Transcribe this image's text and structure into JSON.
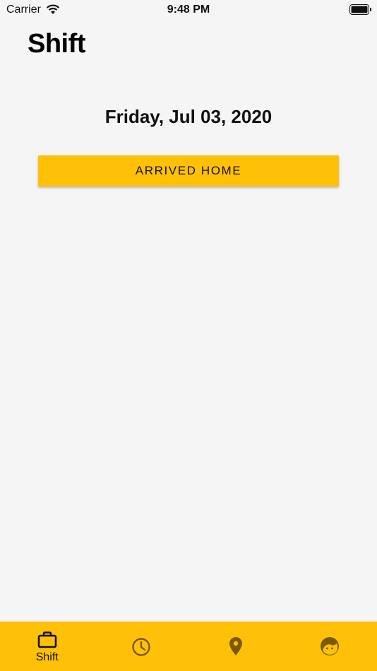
{
  "status_bar": {
    "carrier": "Carrier",
    "time": "9:48 PM"
  },
  "header": {
    "title": "Shift"
  },
  "main": {
    "date": "Friday, Jul 03, 2020",
    "action_button_label": "ARRIVED HOME"
  },
  "tab_bar": {
    "background": "#ffc107",
    "active_color": "#111111",
    "inactive_color": "#7a5a00",
    "tabs": [
      {
        "icon": "briefcase-icon",
        "label": "Shift",
        "active": true
      },
      {
        "icon": "clock-icon",
        "label": "",
        "active": false
      },
      {
        "icon": "location-pin-icon",
        "label": "",
        "active": false
      },
      {
        "icon": "face-icon",
        "label": "",
        "active": false
      }
    ]
  },
  "colors": {
    "accent": "#ffc107",
    "background": "#f5f5f5"
  }
}
